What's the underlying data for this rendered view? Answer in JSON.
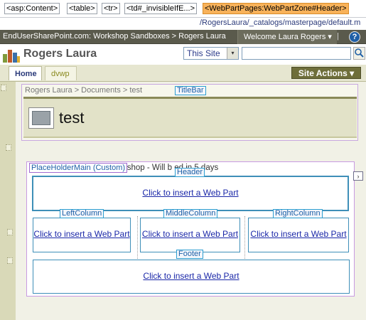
{
  "crumb_tags": [
    "<asp:Content>",
    "<table>",
    "<tr>",
    "<td#_invisibleIfE...>",
    "<WebPartPages:WebPartZone#Header>"
  ],
  "url_path": "/RogersLaura/_catalogs/masterpage/default.m",
  "topnav": {
    "site_path": "EndUserSharePoint.com: Workshop Sandboxes > Rogers Laura",
    "welcome": "Welcome Laura Rogers",
    "welcome_arrow": "▾",
    "separator": "|",
    "help_glyph": "?"
  },
  "header": {
    "site_title": "Rogers Laura",
    "search_scope": "This Site",
    "search_scope_arrow": "▾",
    "search_value": "",
    "search_icon": "search-icon"
  },
  "tabs": [
    "Home",
    "dvwp"
  ],
  "site_actions": "Site Actions ▾",
  "titlebar": {
    "breadcrumb": "Rogers Laura > Documents > test",
    "zone_label": "TitleBar",
    "page_title": "test"
  },
  "main": {
    "placeholder_label": "PlaceHolderMain (Custom)",
    "placeholder_text": "kshop - Will b      ed in 5 days",
    "expand": "›",
    "zones": {
      "header": "Header",
      "left": "LeftColumn",
      "middle": "MiddleColumn",
      "right": "RightColumn",
      "footer": "Footer"
    },
    "insert_text": "Click to insert a Web Part"
  }
}
